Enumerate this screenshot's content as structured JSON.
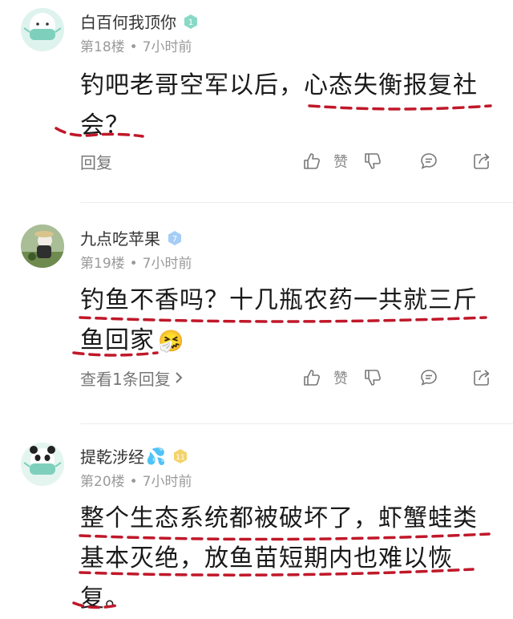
{
  "comments": [
    {
      "username": "白百何我顶你",
      "level": "1",
      "floor": "第18楼",
      "time": "7小时前",
      "content_line1": "钓吧老哥空军以后，心态失衡报复社",
      "content_line2": "会？",
      "reply_label": "回复",
      "like_label": "赞"
    },
    {
      "username": "九点吃苹果",
      "level": "7",
      "floor": "第19楼",
      "time": "7小时前",
      "content_line1": "钓鱼不香吗？十几瓶农药一共就三斤",
      "content_line2": "鱼回家",
      "emoji": "🤧",
      "reply_label": "查看1条回复",
      "like_label": "赞"
    },
    {
      "username": "提乾涉经",
      "level": "11",
      "emoji": "💦",
      "floor": "第20楼",
      "time": "7小时前",
      "content_line1": "整个生态系统都被破坏了，虾蟹蛙类",
      "content_line2": "基本灭绝，放鱼苗短期内也难以恢",
      "content_line3": "复。"
    }
  ],
  "separator": "•",
  "colors": {
    "annotation": "#c0182a",
    "meta": "#9a9a9a",
    "level_teal": "#7fd6c2",
    "level_blue": "#9cc8f5",
    "level_gold": "#f3d36b"
  },
  "icons": [
    "thumbs-up-icon",
    "thumbs-down-icon",
    "comment-icon",
    "share-icon",
    "chevron-right-icon"
  ]
}
